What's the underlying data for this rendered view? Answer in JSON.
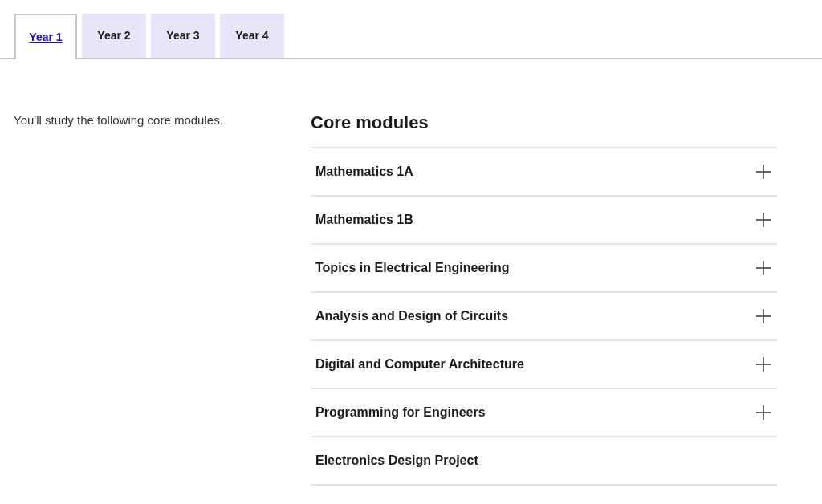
{
  "tabs": [
    {
      "label": "Year 1",
      "selected": true
    },
    {
      "label": "Year 2",
      "selected": false
    },
    {
      "label": "Year 3",
      "selected": false
    },
    {
      "label": "Year 4",
      "selected": false
    }
  ],
  "intro": "You'll study the following core modules.",
  "section": {
    "title": "Core modules",
    "modules": [
      {
        "title": "Mathematics 1A",
        "kind": "expandable"
      },
      {
        "title": "Mathematics 1B",
        "kind": "expandable"
      },
      {
        "title": "Topics in Electrical Engineering",
        "kind": "expandable"
      },
      {
        "title": "Analysis and Design of Circuits",
        "kind": "expandable"
      },
      {
        "title": "Digital and Computer Architecture",
        "kind": "expandable"
      },
      {
        "title": "Programming for Engineers",
        "kind": "expandable"
      },
      {
        "title": "Electronics Design Project",
        "kind": "plain"
      }
    ]
  }
}
